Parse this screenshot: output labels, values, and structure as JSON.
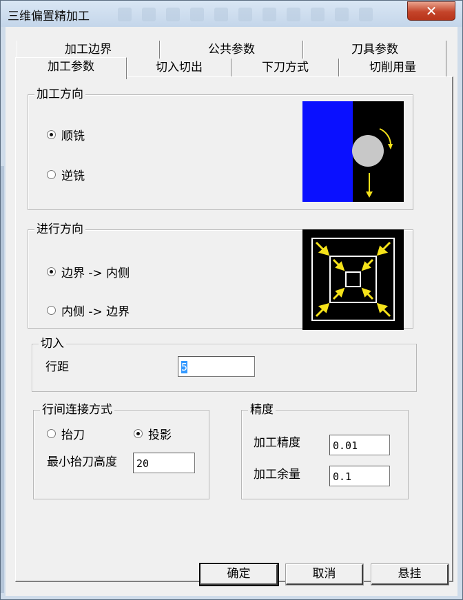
{
  "window": {
    "title": "三维偏置精加工",
    "close_label": "✕"
  },
  "tabs": {
    "back_row": [
      "加工边界",
      "公共参数",
      "刀具参数"
    ],
    "front_row": [
      "加工参数",
      "切入切出",
      "下刀方式",
      "切削用量"
    ],
    "active": "加工参数"
  },
  "machining_direction": {
    "title": "加工方向",
    "options": [
      "顺铣",
      "逆铣"
    ],
    "selected": "顺铣"
  },
  "feed_direction": {
    "title": "进行方向",
    "options": [
      "边界 -> 内侧",
      "内侧 -> 边界"
    ],
    "selected": "边界 -> 内侧"
  },
  "cut_in": {
    "title": "切入",
    "row_spacing_label": "行距",
    "row_spacing_value": "5"
  },
  "row_connection": {
    "title": "行间连接方式",
    "options": [
      "抬刀",
      "投影"
    ],
    "selected": "投影",
    "min_lift_height_label": "最小抬刀高度",
    "min_lift_height_value": "20"
  },
  "precision": {
    "title": "精度",
    "machining_precision_label": "加工精度",
    "machining_precision_value": "0.01",
    "allowance_label": "加工余量",
    "allowance_value": "0.1"
  },
  "buttons": {
    "ok": "确定",
    "cancel": "取消",
    "suspend": "悬挂"
  },
  "colors": {
    "diagram_blue": "#0a10ff",
    "diagram_yellow": "#f5e21a",
    "diagram_black": "#000000"
  }
}
